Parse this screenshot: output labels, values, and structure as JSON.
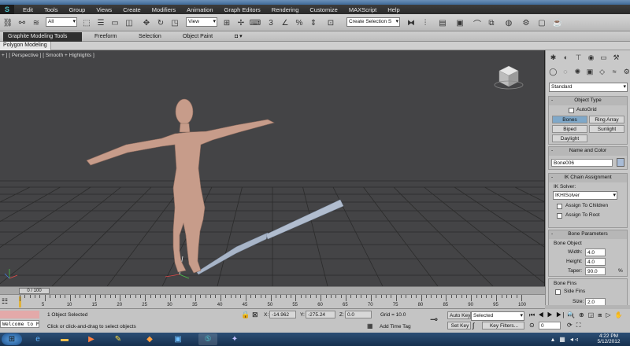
{
  "menubar": {
    "logo": "S",
    "items": [
      "Edit",
      "Tools",
      "Group",
      "Views",
      "Create",
      "Modifiers",
      "Animation",
      "Graph Editors",
      "Rendering",
      "Customize",
      "MAXScript",
      "Help"
    ]
  },
  "toolbar": {
    "selection_filter": "All",
    "ref_coord": "View",
    "named_selection": "Create Selection S"
  },
  "ribbon": {
    "tabs": [
      "Graphite Modeling Tools",
      "Freeform",
      "Selection",
      "Object Paint"
    ],
    "active_tab": "Graphite Modeling Tools",
    "sub_tab": "Polygon Modeling"
  },
  "viewport": {
    "label": "+ ] [ Perspective ] [ Smooth + Highlights ]",
    "bg_color": "#444446",
    "grid_color": "#2a2a2a"
  },
  "command_panel": {
    "category": "Standard",
    "object_type": {
      "title": "Object Type",
      "autogrid": "AutoGrid",
      "buttons": [
        "Bones",
        "Ring Array",
        "Biped",
        "Sunlight",
        "Daylight"
      ],
      "selected": "Bones"
    },
    "name_color": {
      "title": "Name and Color",
      "name": "Bone006",
      "color": "#a9bcd6"
    },
    "ik_chain": {
      "title": "IK Chain Assignment",
      "solver_label": "IK Solver:",
      "solver": "IKHISolver",
      "assign_children": "Assign To Children",
      "assign_root": "Assign To Root"
    },
    "bone_params": {
      "title": "Bone Parameters",
      "group": "Bone Object",
      "width_label": "Width:",
      "width": "4.0",
      "height_label": "Height:",
      "height": "4.0",
      "taper_label": "Taper:",
      "taper": "90.0",
      "taper_unit": "%"
    },
    "bone_fins": {
      "group": "Bone Fins",
      "side_fins": "Side Fins",
      "size_label": "Size:",
      "size": "2.0"
    }
  },
  "timeline": {
    "frame_label": "0 / 100",
    "ticks": [
      "5",
      "10",
      "15",
      "20",
      "25",
      "30",
      "35",
      "40",
      "45",
      "50",
      "55",
      "60",
      "65",
      "70",
      "75",
      "80",
      "85",
      "90",
      "95",
      "100"
    ]
  },
  "status": {
    "maxscript": "Welcome to M",
    "selected": "1 Object Selected",
    "prompt": "Click or click-and-drag to select objects",
    "x_label": "X:",
    "x": "-14.962",
    "y_label": "Y:",
    "y": "-275.24",
    "z_label": "Z:",
    "z": "0.0",
    "grid": "Grid = 10.0",
    "add_time_tag": "Add Time Tag",
    "auto_key": "Auto Key",
    "auto_key_mode": "Selected",
    "set_key": "Set Key",
    "key_filters": "Key Filters...",
    "frame": "0"
  },
  "taskbar": {
    "time": "4:22 PM",
    "date": "5/12/2012"
  }
}
